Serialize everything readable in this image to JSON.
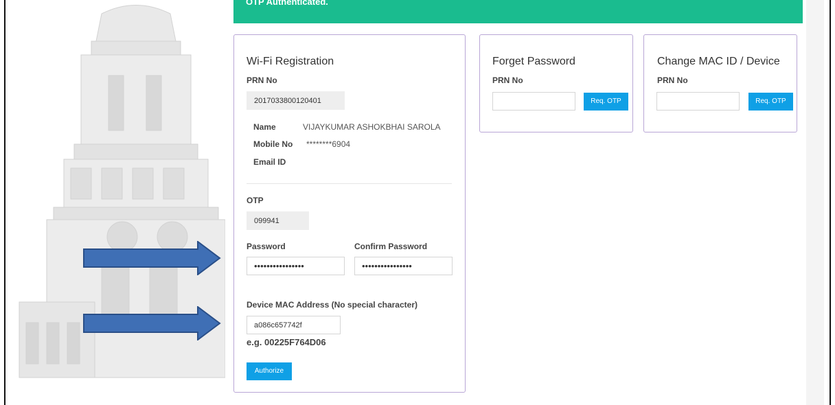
{
  "banner": {
    "text": "OTP Authenticated."
  },
  "wifi": {
    "title": "Wi-Fi Registration",
    "prn_label": "PRN No",
    "prn_value": "2017033800120401",
    "name_label": "Name",
    "name_value": "VIJAYKUMAR ASHOKBHAI SAROLA",
    "mobile_label": "Mobile No",
    "mobile_value": "********6904",
    "email_label": "Email ID",
    "otp_label": "OTP",
    "otp_value": "099941",
    "password_label": "Password",
    "password_value": "••••••••••••••••",
    "confirm_label": "Confirm Password",
    "confirm_value": "••••••••••••••••",
    "mac_label": "Device MAC Address (No special character)",
    "mac_value": "a086c657742f",
    "mac_example": "e.g. 00225F764D06",
    "authorize_label": "Authorize"
  },
  "forget": {
    "title": "Forget Password",
    "prn_label": "PRN No",
    "prn_value": "",
    "req_label": "Req. OTP"
  },
  "change_mac": {
    "title": "Change MAC ID / Device",
    "prn_label": "PRN No",
    "prn_value": "",
    "req_label": "Req. OTP"
  },
  "colors": {
    "banner": "#1abc8f",
    "button": "#0fa0e6",
    "card_border": "#b9a6d6",
    "arrow_fill": "#3f6fb5",
    "arrow_stroke": "#2a4f88"
  },
  "icons": [
    "right-arrow-icon",
    "building-illustration"
  ]
}
